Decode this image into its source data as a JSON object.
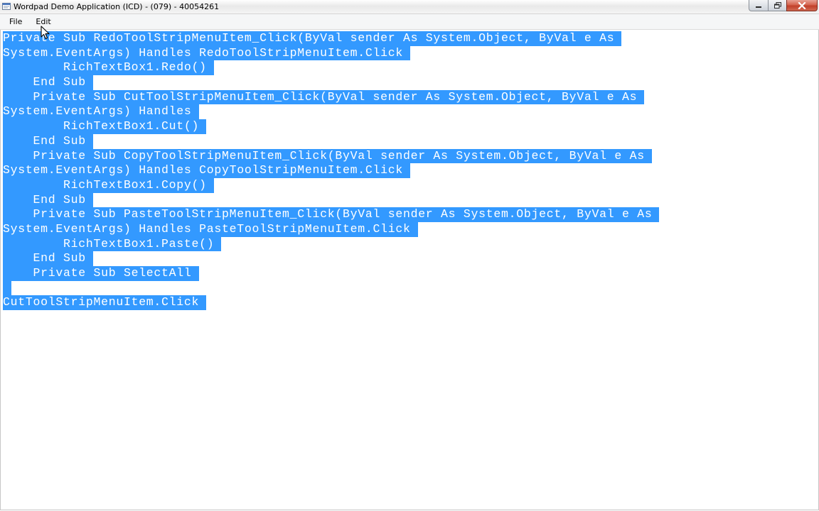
{
  "window": {
    "title": "Wordpad Demo Application (ICD) - (079) - 40054261"
  },
  "icons": {
    "app": "app-window-icon",
    "minimize": "minimize-icon",
    "maximize": "maximize-icon",
    "close": "close-icon",
    "cursor": "mouse-pointer-icon"
  },
  "colors": {
    "selection": "#3399ff",
    "selection_text": "#ffffff",
    "close_button": "#c7432b"
  },
  "menu": {
    "file": "File",
    "edit": "Edit"
  },
  "editor": {
    "lines": [
      "Private Sub RedoToolStripMenuItem_Click(ByVal sender As System.Object, ByVal e As",
      "System.EventArgs) Handles RedoToolStripMenuItem.Click",
      "        RichTextBox1.Redo()",
      "    End Sub",
      "    Private Sub CutToolStripMenuItem_Click(ByVal sender As System.Object, ByVal e As",
      "System.EventArgs) Handles",
      "        RichTextBox1.Cut()",
      "    End Sub",
      "    Private Sub CopyToolStripMenuItem_Click(ByVal sender As System.Object, ByVal e As",
      "System.EventArgs) Handles CopyToolStripMenuItem.Click",
      "        RichTextBox1.Copy()",
      "    End Sub",
      "    Private Sub PasteToolStripMenuItem_Click(ByVal sender As System.Object, ByVal e As",
      "System.EventArgs) Handles PasteToolStripMenuItem.Click",
      "        RichTextBox1.Paste()",
      "    End Sub",
      "    Private Sub SelectAll",
      "",
      "CutToolStripMenuItem.Click"
    ]
  }
}
